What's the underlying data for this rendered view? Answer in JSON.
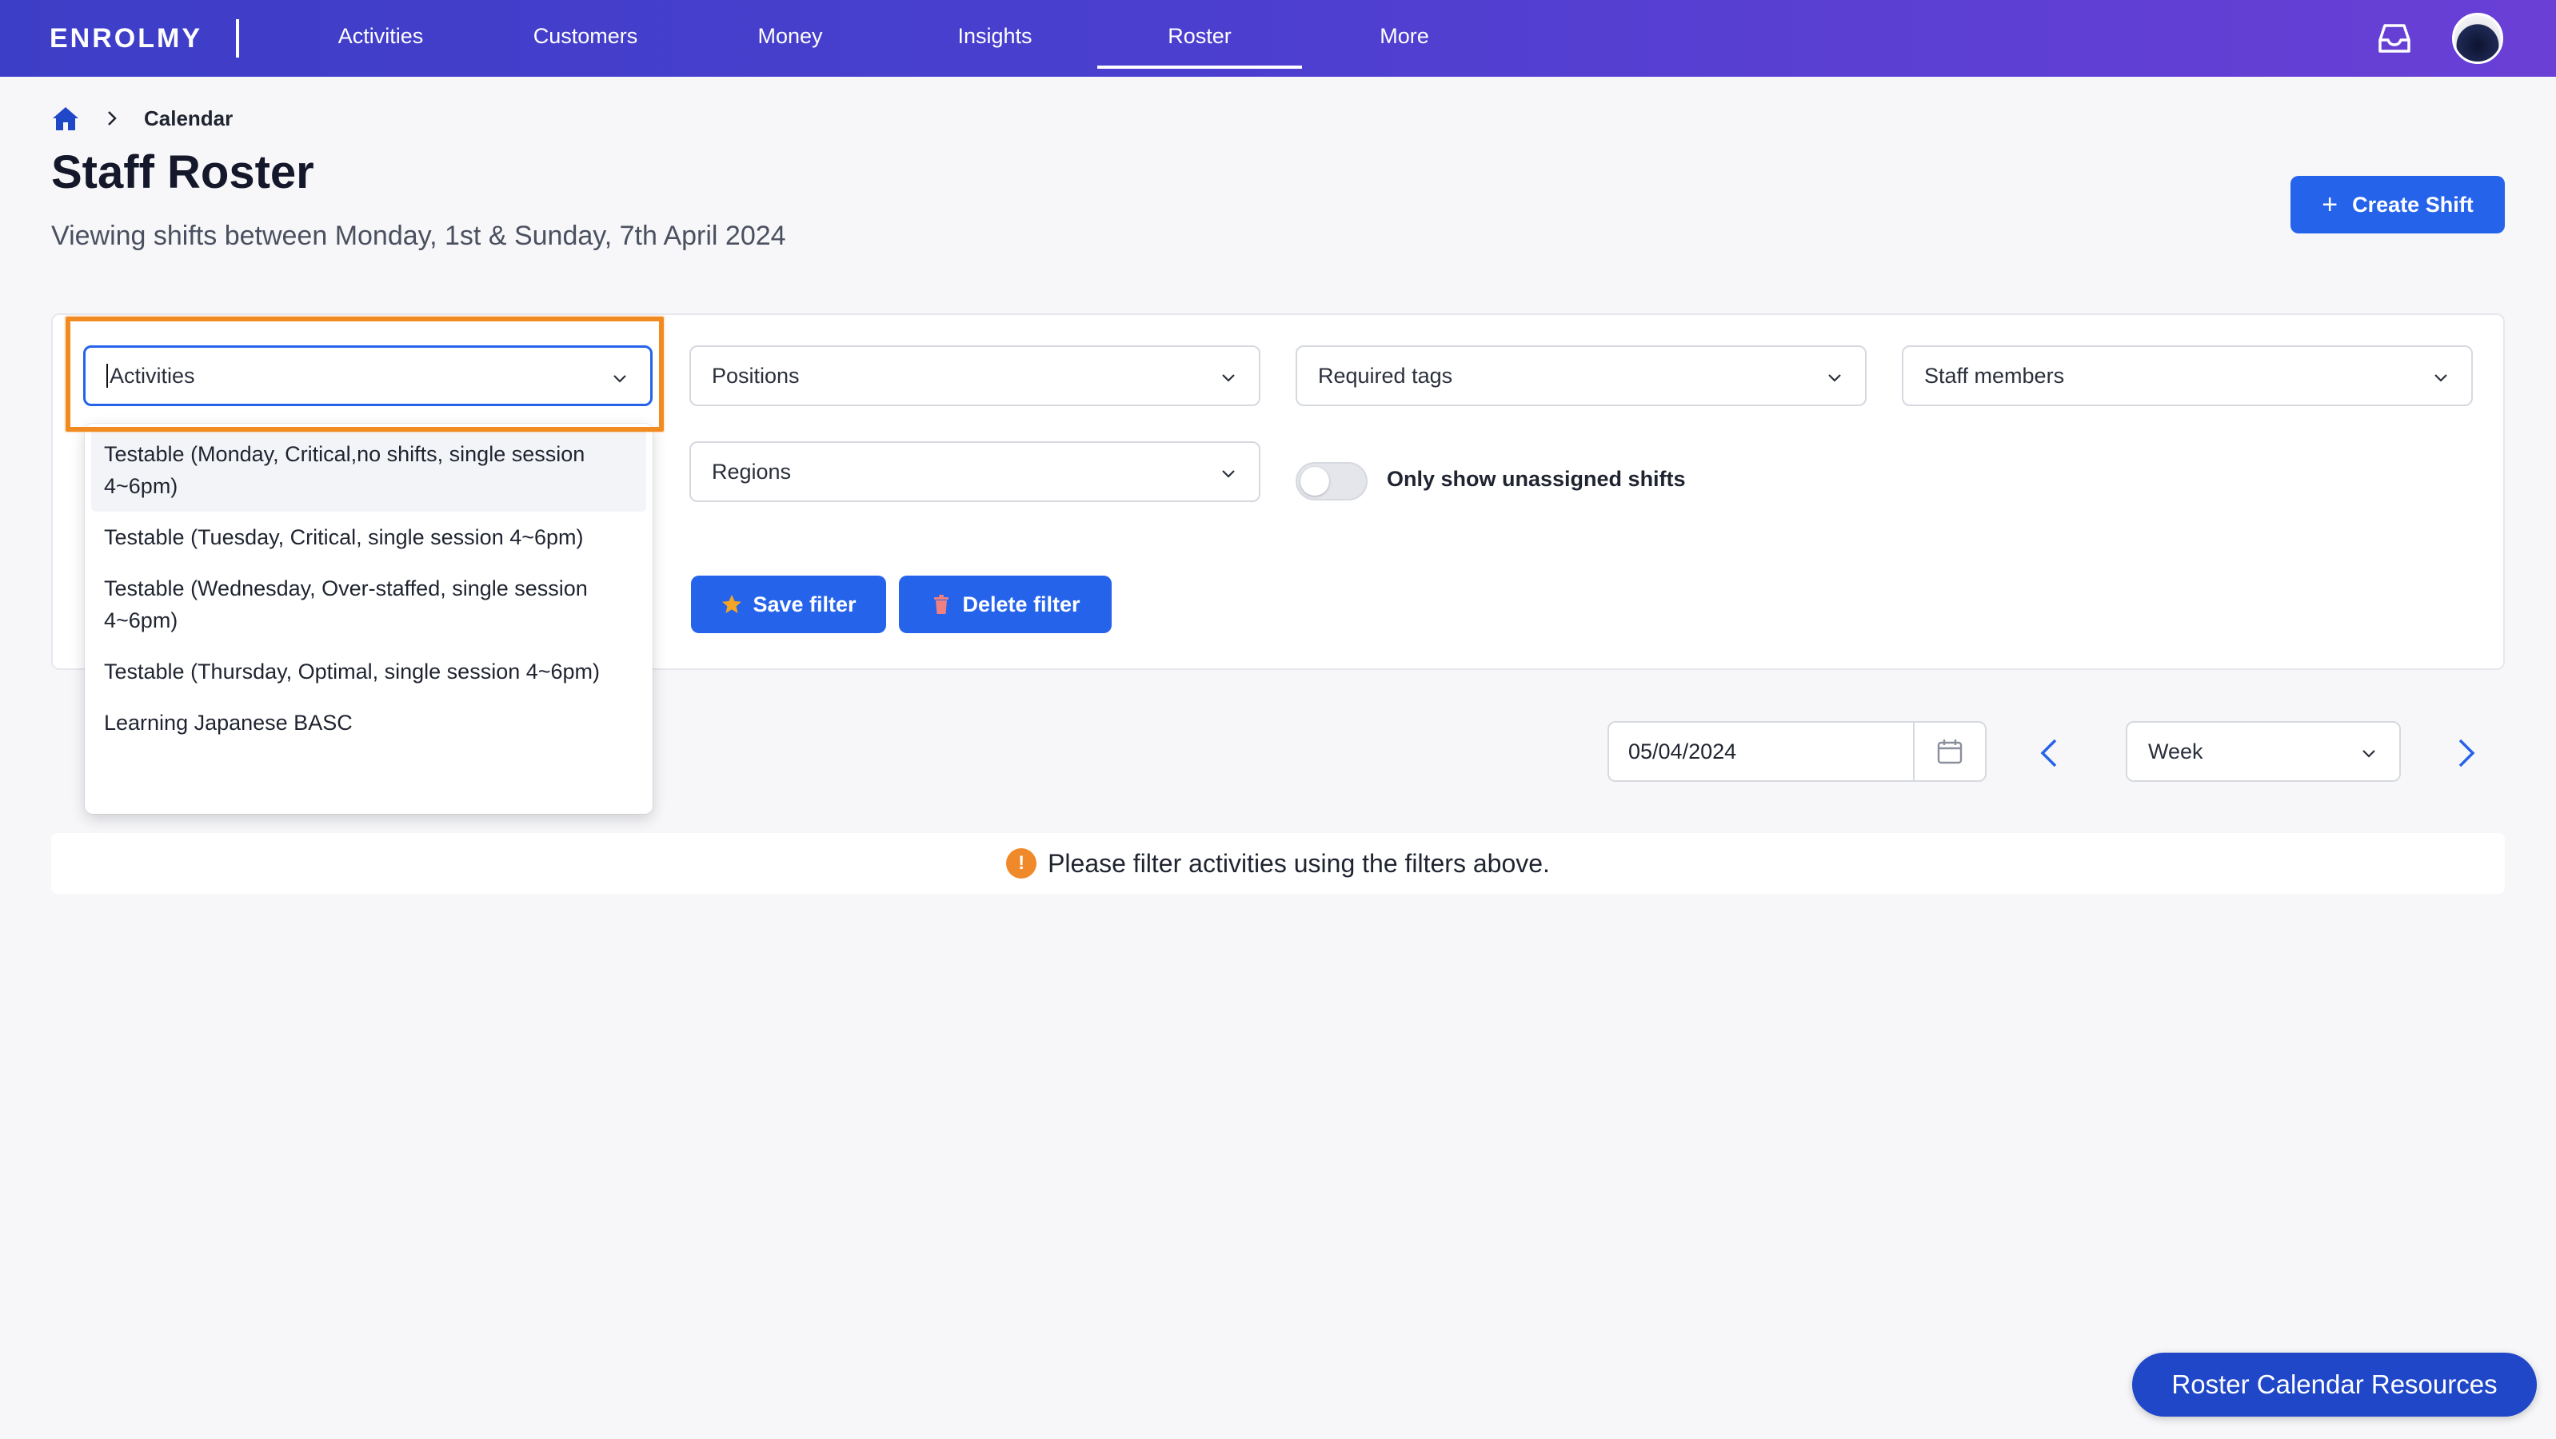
{
  "brand": {
    "logo_text": "ENROLMY",
    "primary": "#2563eb",
    "nav_gradient": [
      "#3d3ec7",
      "#6a3fd6"
    ],
    "highlight": "#f28a22"
  },
  "nav": {
    "items": [
      {
        "label": "Activities"
      },
      {
        "label": "Customers"
      },
      {
        "label": "Money"
      },
      {
        "label": "Insights"
      },
      {
        "label": "Roster"
      },
      {
        "label": "More"
      }
    ],
    "active": "Roster",
    "inbox_icon": "inbox-icon",
    "avatar_icon": "avatar"
  },
  "breadcrumb": {
    "home_icon": "home-icon",
    "current": "Calendar"
  },
  "header": {
    "title": "Staff Roster",
    "subtitle": "Viewing shifts between Monday, 1st & Sunday, 7th April 2024",
    "create_button": "Create Shift"
  },
  "filters": {
    "activities_placeholder": "Activities",
    "positions_placeholder": "Positions",
    "required_tags_placeholder": "Required tags",
    "staff_members_placeholder": "Staff members",
    "regions_placeholder": "Regions",
    "unassigned_toggle_label": "Only show unassigned shifts",
    "unassigned_toggle_on": false,
    "save_filter": "Save filter",
    "delete_filter": "Delete filter"
  },
  "activities_dropdown": {
    "options": [
      "Testable (Monday, Critical,no shifts, single session 4~6pm)",
      "Testable (Tuesday, Critical, single session 4~6pm)",
      "Testable (Wednesday, Over-staffed, single session 4~6pm)",
      "Testable (Thursday, Optimal, single session 4~6pm)",
      "Learning Japanese BASC"
    ]
  },
  "calendar": {
    "date_value": "05/04/2024",
    "view_mode": "Week"
  },
  "notice": {
    "text": "Please filter activities using the filters above.",
    "icon": "!"
  },
  "resources_button": "Roster Calendar Resources"
}
